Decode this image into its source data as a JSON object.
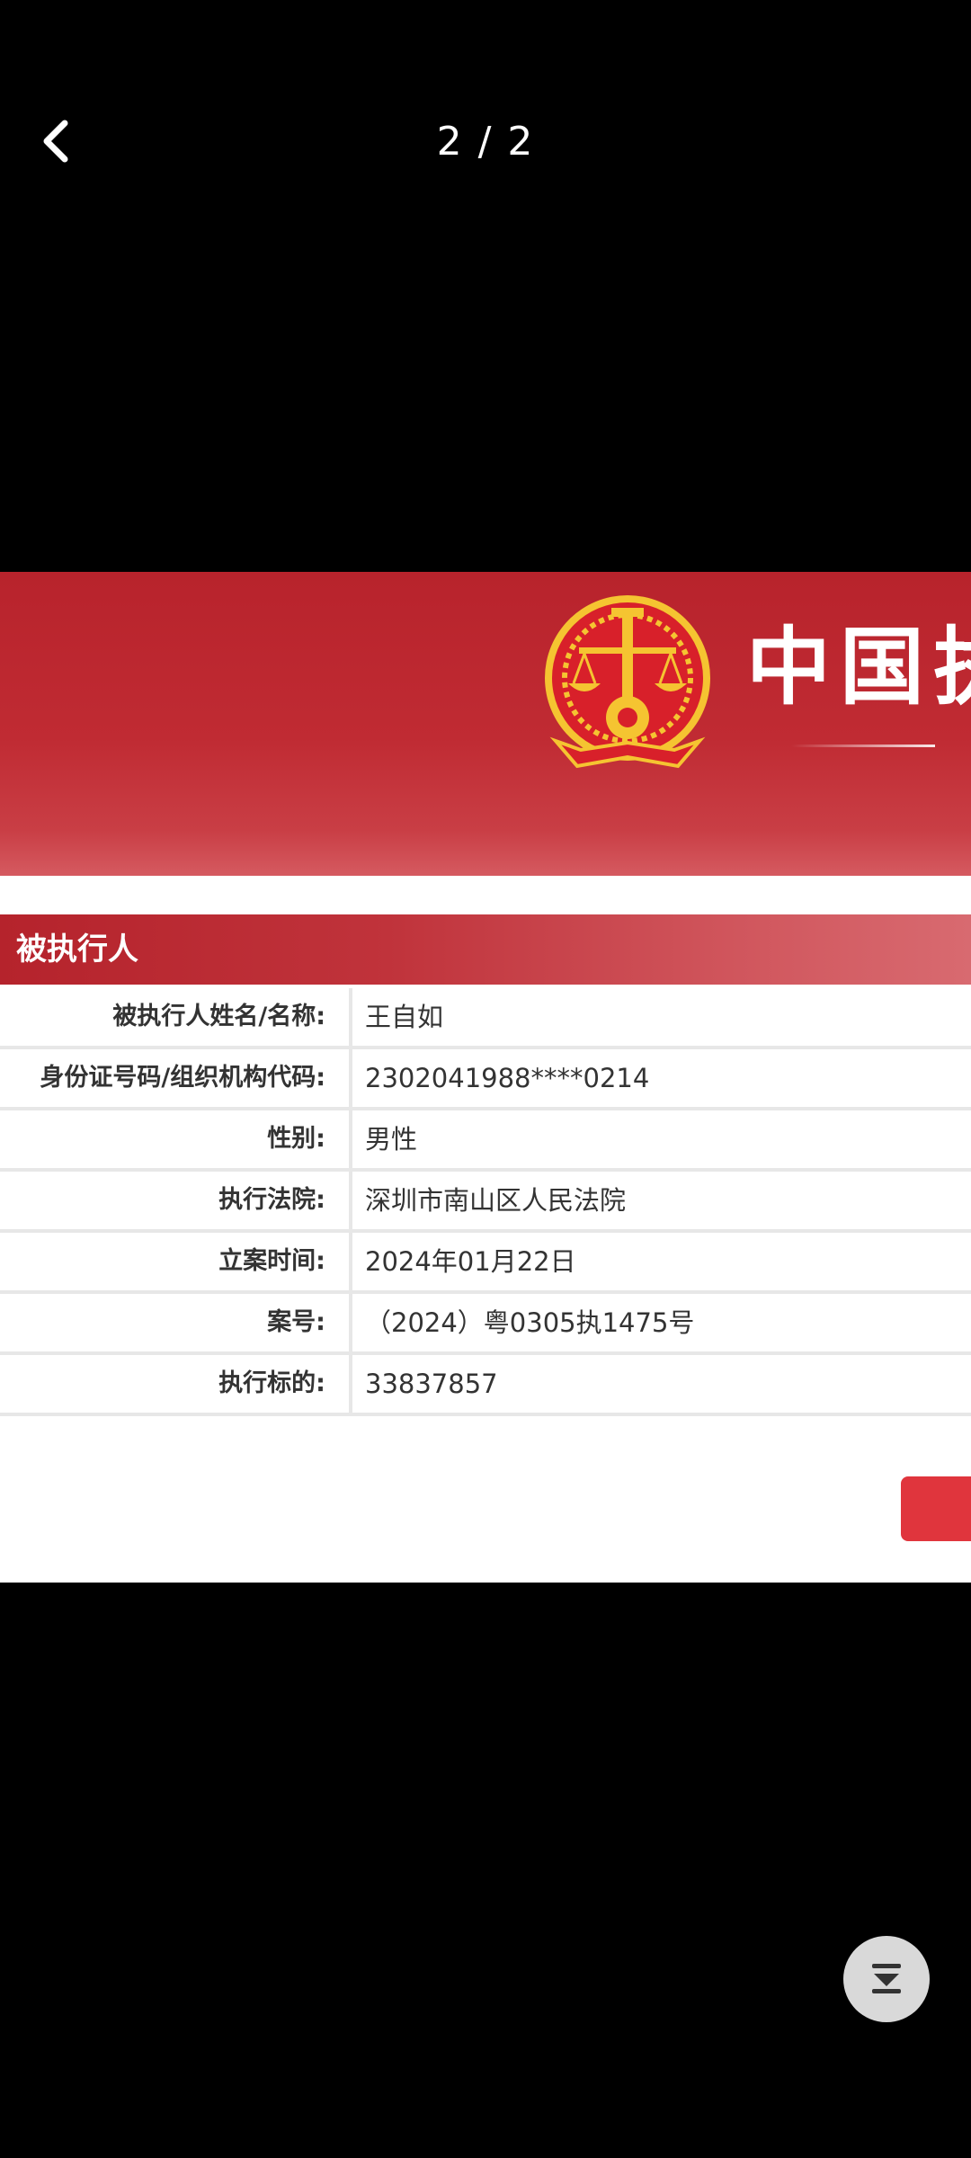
{
  "viewer": {
    "counter": "2 / 2",
    "back_icon": "chevron-left-icon",
    "fab_icon": "double-chevron-down-icon"
  },
  "photo": {
    "banner": {
      "title": "中国执",
      "emblem_icon": "court-emblem-icon",
      "colors": {
        "primary": "#b8232c",
        "emblem_gold": "#f5c431",
        "emblem_red": "#d8202a"
      }
    },
    "section": {
      "title": "被执行人"
    },
    "rows": [
      {
        "label": "被执行人姓名/名称:",
        "value": "王自如"
      },
      {
        "label": "身份证号码/组织机构代码:",
        "value": "2302041988****0214"
      },
      {
        "label": "性别:",
        "value": "男性"
      },
      {
        "label": "执行法院:",
        "value": "深圳市南山区人民法院"
      },
      {
        "label": "立案时间:",
        "value": "2024年01月22日"
      },
      {
        "label": "案号:",
        "value": "（2024）粤0305执1475号"
      },
      {
        "label": "执行标的:",
        "value": "33837857"
      }
    ],
    "button_color": "#e0353d"
  }
}
